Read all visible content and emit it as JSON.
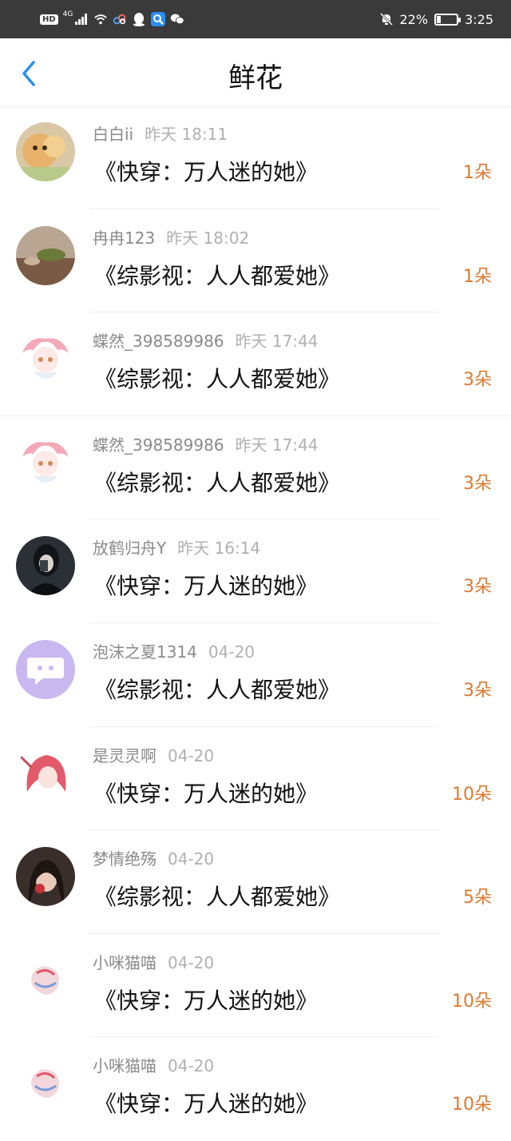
{
  "status_bar": {
    "hd": "HD",
    "network": "4G",
    "battery_text": "22%",
    "battery_level": 0.22,
    "time": "3:25"
  },
  "header": {
    "title": "鲜花"
  },
  "rows": [
    {
      "user": "白白ii",
      "time": "昨天 18:11",
      "book": "《快穿：万人迷的她》",
      "count": "1朵"
    },
    {
      "user": "冉冉123",
      "time": "昨天 18:02",
      "book": "《综影视：人人都爱她》",
      "count": "1朵"
    },
    {
      "user": "蝶然_398589986",
      "time": "昨天 17:44",
      "book": "《综影视：人人都爱她》",
      "count": "3朵"
    },
    {
      "user": "蝶然_398589986",
      "time": "昨天 17:44",
      "book": "《综影视：人人都爱她》",
      "count": "3朵"
    },
    {
      "user": "放鹤归舟Y",
      "time": "昨天 16:14",
      "book": "《快穿：万人迷的她》",
      "count": "3朵"
    },
    {
      "user": "泡沫之夏1314",
      "time": "04-20",
      "book": "《综影视：人人都爱她》",
      "count": "3朵"
    },
    {
      "user": "是灵灵啊",
      "time": "04-20",
      "book": "《快穿：万人迷的她》",
      "count": "10朵"
    },
    {
      "user": "梦情绝殇",
      "time": "04-20",
      "book": "《综影视：人人都爱她》",
      "count": "5朵"
    },
    {
      "user": "小咪猫喵",
      "time": "04-20",
      "book": "《快穿：万人迷的她》",
      "count": "10朵"
    },
    {
      "user": "小咪猫喵",
      "time": "04-20",
      "book": "《快穿：万人迷的她》",
      "count": "10朵"
    }
  ],
  "colors": {
    "accent": "#2a8ef2",
    "count": "#e0782f",
    "username": "#8a8a8a",
    "timestamp": "#b0b0b0",
    "status_bar": "#3a3a3a"
  }
}
